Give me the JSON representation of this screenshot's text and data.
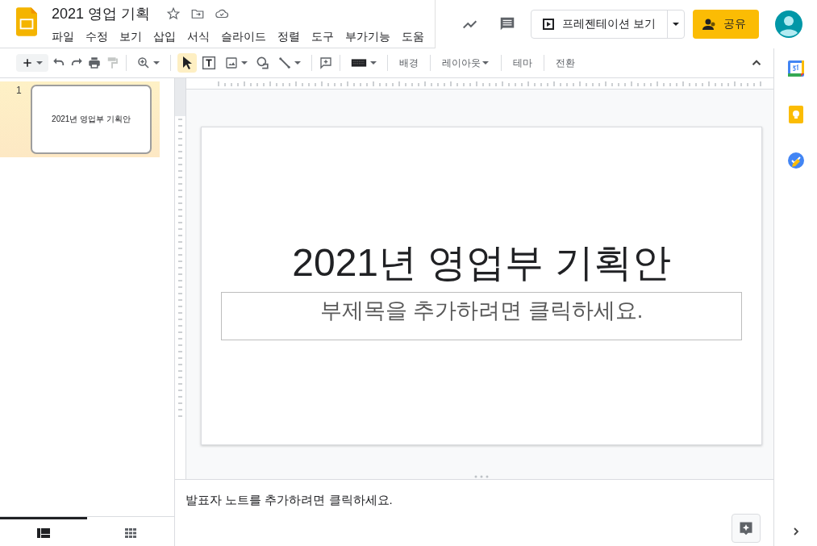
{
  "document": {
    "title": "2021 영업 기획"
  },
  "menu": [
    "파일",
    "수정",
    "보기",
    "삽입",
    "서식",
    "슬라이드",
    "정렬",
    "도구",
    "부가기능",
    "도움"
  ],
  "present_button": {
    "label": "프레젠테이션 보기"
  },
  "share_button": {
    "label": "공유"
  },
  "toolbar": {
    "select_tool_selected": true,
    "text_buttons": [
      {
        "label": "배경",
        "dropdown": false
      },
      {
        "label": "레이아웃",
        "dropdown": true
      },
      {
        "label": "테마",
        "dropdown": false
      },
      {
        "label": "전환",
        "dropdown": false
      }
    ]
  },
  "filmstrip": [
    {
      "number": "1",
      "title": "2021년 영업부 기획안",
      "selected": true
    }
  ],
  "view_toggle": [
    {
      "kind": "filmstrip",
      "selected": true
    },
    {
      "kind": "grid",
      "selected": false
    }
  ],
  "slide": {
    "title": "2021년 영업부 기획안",
    "subtitle_placeholder": "부제목을 추가하려면 클릭하세요."
  },
  "speaker_notes": {
    "placeholder": "발표자 노트를 추가하려면 클릭하세요."
  }
}
